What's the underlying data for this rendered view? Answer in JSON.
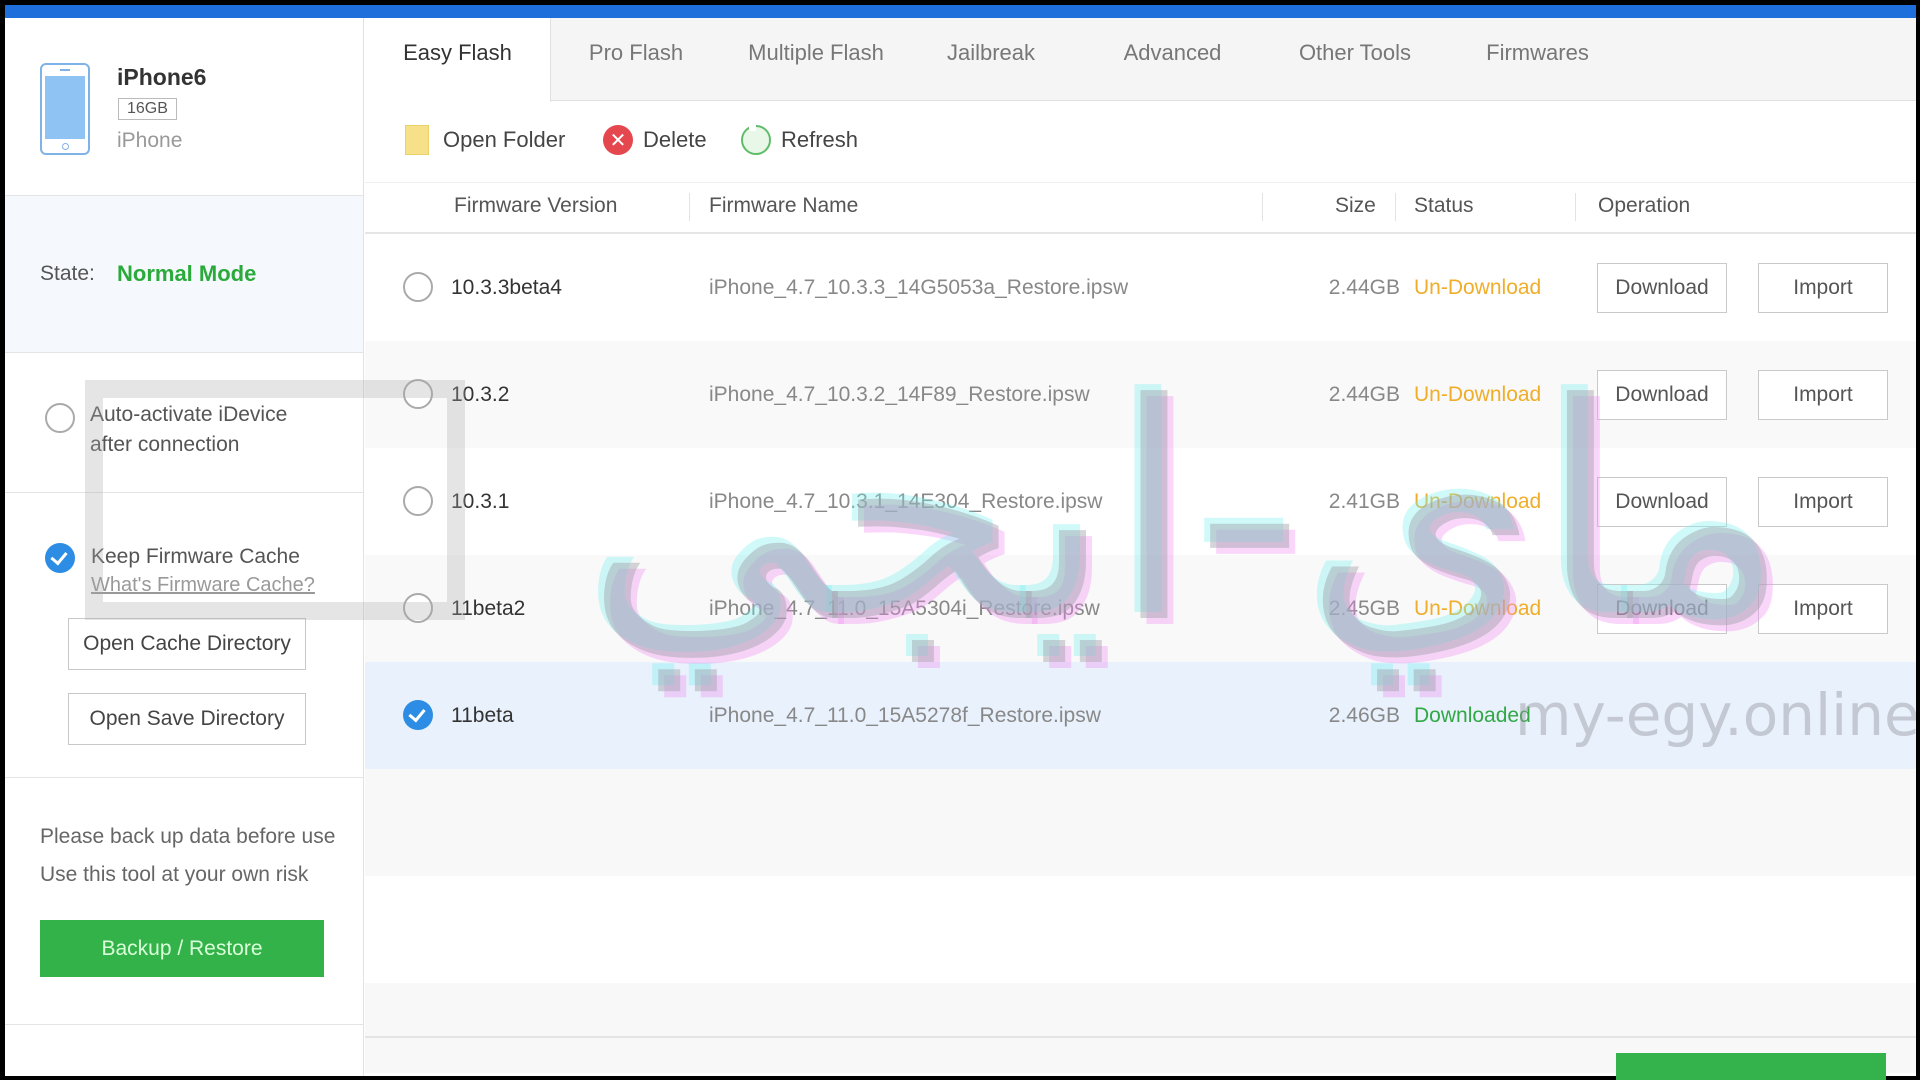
{
  "device": {
    "name": "iPhone6",
    "capacity": "16GB",
    "type": "iPhone",
    "state_label": "State:",
    "state_value": "Normal Mode"
  },
  "sidebar": {
    "auto_activate": {
      "label_line1": "Auto-activate iDevice",
      "label_line2": "after connection",
      "checked": false
    },
    "keep_cache": {
      "label": "Keep Firmware Cache",
      "link": "What's Firmware Cache?",
      "checked": true
    },
    "open_cache_button": "Open Cache Directory",
    "open_save_button": "Open Save Directory",
    "warning_line1": "Please back up data before use",
    "warning_line2": "Use this tool at your own risk",
    "backup_button": "Backup / Restore"
  },
  "tabs": [
    {
      "label": "Easy Flash",
      "active": true
    },
    {
      "label": "Pro Flash",
      "active": false
    },
    {
      "label": "Multiple Flash",
      "active": false
    },
    {
      "label": "Jailbreak",
      "active": false
    },
    {
      "label": "Advanced",
      "active": false
    },
    {
      "label": "Other Tools",
      "active": false
    },
    {
      "label": "Firmwares",
      "active": false
    }
  ],
  "toolbar": {
    "open_folder": "Open Folder",
    "delete": "Delete",
    "refresh": "Refresh"
  },
  "table": {
    "headers": {
      "version": "Firmware Version",
      "name": "Firmware Name",
      "size": "Size",
      "status": "Status",
      "operation": "Operation"
    },
    "rows": [
      {
        "version": "10.3.3beta4",
        "name": "iPhone_4.7_10.3.3_14G5053a_Restore.ipsw",
        "size": "2.44GB",
        "status": "Un-Download",
        "download": "Download",
        "import": "Import",
        "selected": false
      },
      {
        "version": "10.3.2",
        "name": "iPhone_4.7_10.3.2_14F89_Restore.ipsw",
        "size": "2.44GB",
        "status": "Un-Download",
        "download": "Download",
        "import": "Import",
        "selected": false
      },
      {
        "version": "10.3.1",
        "name": "iPhone_4.7_10.3.1_14E304_Restore.ipsw",
        "size": "2.41GB",
        "status": "Un-Download",
        "download": "Download",
        "import": "Import",
        "selected": false
      },
      {
        "version": "11beta2",
        "name": "iPhone_4.7_11.0_15A5304i_Restore.ipsw",
        "size": "2.45GB",
        "status": "Un-Download",
        "download": "Download",
        "import": "Import",
        "selected": false
      },
      {
        "version": "11beta",
        "name": "iPhone_4.7_11.0_15A5278f_Restore.ipsw",
        "size": "2.46GB",
        "status": "Downloaded",
        "selected": true
      }
    ]
  },
  "watermark": {
    "arabic": "ماي-ايجي",
    "site": "my-egy.online"
  },
  "colors": {
    "accent_blue": "#1e6fdc",
    "status_undownloaded": "#f0ad2a",
    "status_downloaded": "#32a845",
    "state_normal": "#2aaa3a",
    "backup_green": "#33b24a"
  }
}
